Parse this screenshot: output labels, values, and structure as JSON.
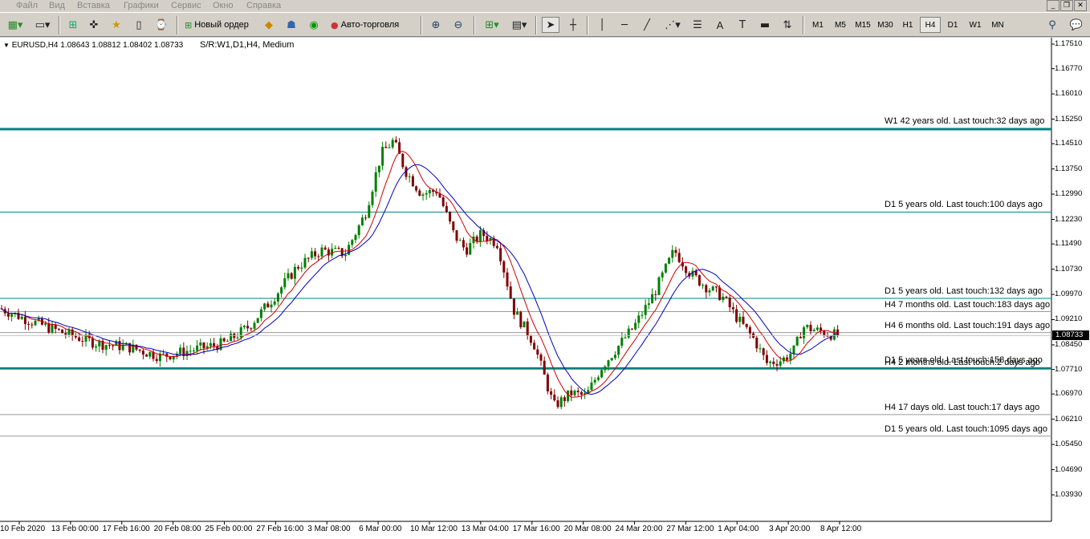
{
  "menu": [
    "Файл",
    "Вид",
    "Вставка",
    "Графики",
    "Сервис",
    "Окно",
    "Справка"
  ],
  "toolbar": {
    "new_order": "Новый ордер",
    "auto_trading": "Авто-торговля",
    "timeframes": [
      "M1",
      "M5",
      "M15",
      "M30",
      "H1",
      "H4",
      "D1",
      "W1",
      "MN"
    ],
    "active_timeframe": "H4"
  },
  "chart": {
    "symbol_info": "EURUSD,H4  1.08643 1.08812 1.08402 1.08733",
    "indicator_info": "S/R:W1,D1,H4, Medium",
    "current_price": "1.08733",
    "price_axis": [
      "1.17510",
      "1.16770",
      "1.16010",
      "1.15250",
      "1.14510",
      "1.13750",
      "1.12990",
      "1.12230",
      "1.11490",
      "1.10730",
      "1.09970",
      "1.09210",
      "1.08450",
      "1.07710",
      "1.06970",
      "1.06210",
      "1.05450",
      "1.04690",
      "1.03930"
    ],
    "time_axis": [
      "10 Feb 2020",
      "13 Feb 00:00",
      "17 Feb 16:00",
      "20 Feb 08:00",
      "25 Feb 00:00",
      "27 Feb 16:00",
      "3 Mar 08:00",
      "6 Mar 00:00",
      "10 Mar 12:00",
      "13 Mar 04:00",
      "17 Mar 16:00",
      "20 Mar 08:00",
      "24 Mar 20:00",
      "27 Mar 12:00",
      "1 Apr 04:00",
      "3 Apr 20:00",
      "8 Apr 12:00"
    ],
    "levels": [
      {
        "label": "W1 42 years old. Last touch:32 days ago",
        "price": 1.1495,
        "color": "#008080",
        "width": 3
      },
      {
        "label": "D1 5 years old. Last touch:100 days ago",
        "price": 1.1245,
        "color": "#008080",
        "width": 1
      },
      {
        "label": "D1 5 years old. Last touch:132 days ago",
        "price": 1.0985,
        "color": "#008080",
        "width": 1
      },
      {
        "label": "H4 7 months old. Last touch:183 days ago",
        "price": 1.0945,
        "color": "#999999",
        "width": 1
      },
      {
        "label": "H4 6 months old. Last touch:191 days ago",
        "price": 1.0882,
        "color": "#999999",
        "width": 1
      },
      {
        "label": "D1 5 years old. Last touch:158 days ago",
        "price": 1.0774,
        "color": "#008080",
        "width": 3
      },
      {
        "label": "H4 2 months old. Last touch:2 days ago",
        "price": 1.0771,
        "color": "#999999",
        "width": 1
      },
      {
        "label": "H4 17 days old. Last touch:17 days ago",
        "price": 1.0635,
        "color": "#999999",
        "width": 1
      },
      {
        "label": "D1 5 years old. Last touch:1095 days ago",
        "price": 1.057,
        "color": "#999999",
        "width": 1
      }
    ],
    "colors": {
      "bull": "#008000",
      "bear": "#800000",
      "ma_fast": "#0000c0",
      "ma_slow": "#d00000"
    }
  }
}
